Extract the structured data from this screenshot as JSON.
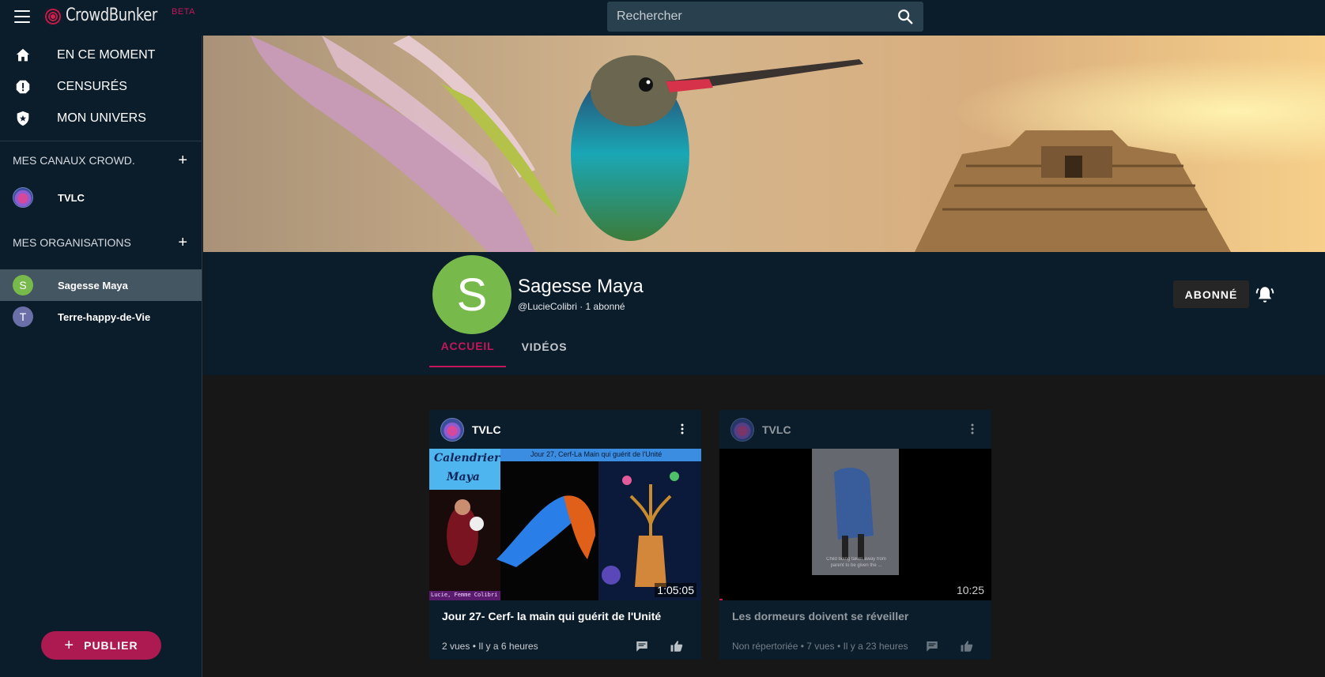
{
  "header": {
    "logo_text": "CrowdBunker",
    "logo_badge": "BETA",
    "search_placeholder": "Rechercher"
  },
  "sidebar": {
    "nav": [
      {
        "label": "EN CE MOMENT",
        "icon": "home-icon"
      },
      {
        "label": "CENSURÉS",
        "icon": "alert-icon"
      },
      {
        "label": "MON UNIVERS",
        "icon": "shield-star-icon"
      }
    ],
    "channels_heading": "MES CANAUX CROWD.",
    "channels": [
      {
        "label": "TVLC"
      }
    ],
    "orgs_heading": "MES ORGANISATIONS",
    "orgs": [
      {
        "label": "Sagesse Maya",
        "initial": "S",
        "color": "#78b94c",
        "active": true
      },
      {
        "label": "Terre-happy-de-Vie",
        "initial": "T",
        "color": "#6a6fa8",
        "active": false
      }
    ],
    "publish_label": "PUBLIER"
  },
  "channel": {
    "initial": "S",
    "name": "Sagesse Maya",
    "subtitle": "@LucieColibri · 1 abonné",
    "subscribed_label": "ABONNÉ",
    "tabs": [
      {
        "label": "ACCUEIL",
        "active": true
      },
      {
        "label": "VIDÉOS",
        "active": false
      }
    ]
  },
  "videos": [
    {
      "channel": "TVLC",
      "title": "Jour 27- Cerf- la main qui guérit de l'Unité",
      "duration": "1:05:05",
      "meta": "2 vues • Il y a 6 heures",
      "thumb_heading_1": "Calendrier",
      "thumb_heading_2": "Maya",
      "thumb_caption": "Jour 27, Cerf-La Main qui guérit de l'Unité",
      "thumb_footer": "Lucie, Femme Colibri"
    },
    {
      "channel": "TVLC",
      "title": "Les dormeurs doivent se réveiller",
      "duration": "10:25",
      "meta": "Non répertoriée • 7 vues • Il y a 23 heures",
      "thumb_caption": "Child being taken away from parent to be given the ..."
    }
  ],
  "colors": {
    "accent": "#c2185b",
    "panel": "#0b1c2b",
    "background": "#171717"
  }
}
